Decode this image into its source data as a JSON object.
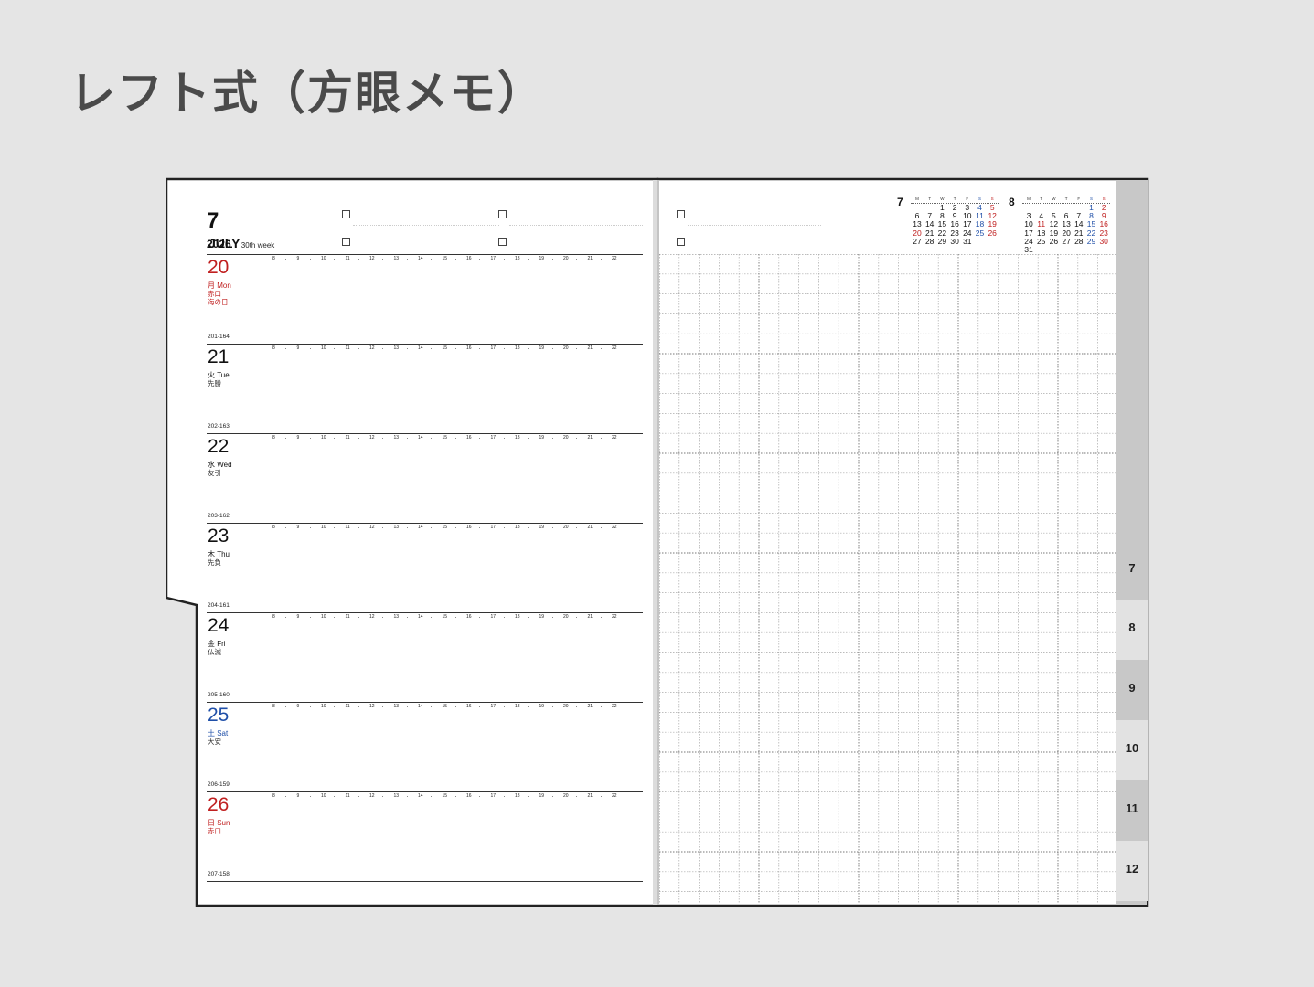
{
  "heading": "レフト式（方眼メモ）",
  "planner": {
    "month_num": "7",
    "month_name": "JULY",
    "year": "2026",
    "week": "30th week",
    "hours": [
      "8",
      "9",
      "10",
      "11",
      "12",
      "13",
      "14",
      "15",
      "16",
      "17",
      "18",
      "19",
      "20",
      "21",
      "22"
    ],
    "days": [
      {
        "num": "20",
        "weekday": "月 Mon",
        "rokuyo": "赤口",
        "holiday": "海の日",
        "count": "201-164",
        "color": "red"
      },
      {
        "num": "21",
        "weekday": "火 Tue",
        "rokuyo": "先勝",
        "holiday": "",
        "count": "202-163",
        "color": "black"
      },
      {
        "num": "22",
        "weekday": "水 Wed",
        "rokuyo": "友引",
        "holiday": "",
        "count": "203-162",
        "color": "black"
      },
      {
        "num": "23",
        "weekday": "木 Thu",
        "rokuyo": "先負",
        "holiday": "",
        "count": "204-161",
        "color": "black"
      },
      {
        "num": "24",
        "weekday": "金 Fri",
        "rokuyo": "仏滅",
        "holiday": "",
        "count": "205-160",
        "color": "black"
      },
      {
        "num": "25",
        "weekday": "土 Sat",
        "rokuyo": "大安",
        "holiday": "",
        "count": "206-159",
        "color": "blue"
      },
      {
        "num": "26",
        "weekday": "日 Sun",
        "rokuyo": "赤口",
        "holiday": "",
        "count": "207-158",
        "color": "red"
      }
    ],
    "mini_calendars": [
      {
        "month": "7",
        "headers": [
          "M",
          "T",
          "W",
          "T",
          "F",
          "S",
          "S"
        ],
        "weeks": [
          [
            "",
            "",
            "1",
            "2",
            "3",
            "4",
            "5"
          ],
          [
            "6",
            "7",
            "8",
            "9",
            "10",
            "11",
            "12"
          ],
          [
            "13",
            "14",
            "15",
            "16",
            "17",
            "18",
            "19"
          ],
          [
            "20",
            "21",
            "22",
            "23",
            "24",
            "25",
            "26"
          ],
          [
            "27",
            "28",
            "29",
            "30",
            "31",
            "",
            ""
          ]
        ]
      },
      {
        "month": "8",
        "headers": [
          "M",
          "T",
          "W",
          "T",
          "F",
          "S",
          "S"
        ],
        "weeks": [
          [
            "",
            "",
            "",
            "",
            "",
            "1",
            "2"
          ],
          [
            "3",
            "4",
            "5",
            "6",
            "7",
            "8",
            "9"
          ],
          [
            "10",
            "11",
            "12",
            "13",
            "14",
            "15",
            "16"
          ],
          [
            "17",
            "18",
            "19",
            "20",
            "21",
            "22",
            "23"
          ],
          [
            "24",
            "25",
            "26",
            "27",
            "28",
            "29",
            "30"
          ],
          [
            "31",
            "",
            "",
            "",
            "",
            "",
            ""
          ]
        ]
      }
    ],
    "tabs": [
      "7",
      "8",
      "9",
      "10",
      "11",
      "12"
    ]
  },
  "colors": {
    "sunday_red": "#c02020",
    "saturday_blue": "#1f4fa8",
    "tab_gray": "#c8c8c8",
    "tab_light": "#e2e2e2"
  }
}
